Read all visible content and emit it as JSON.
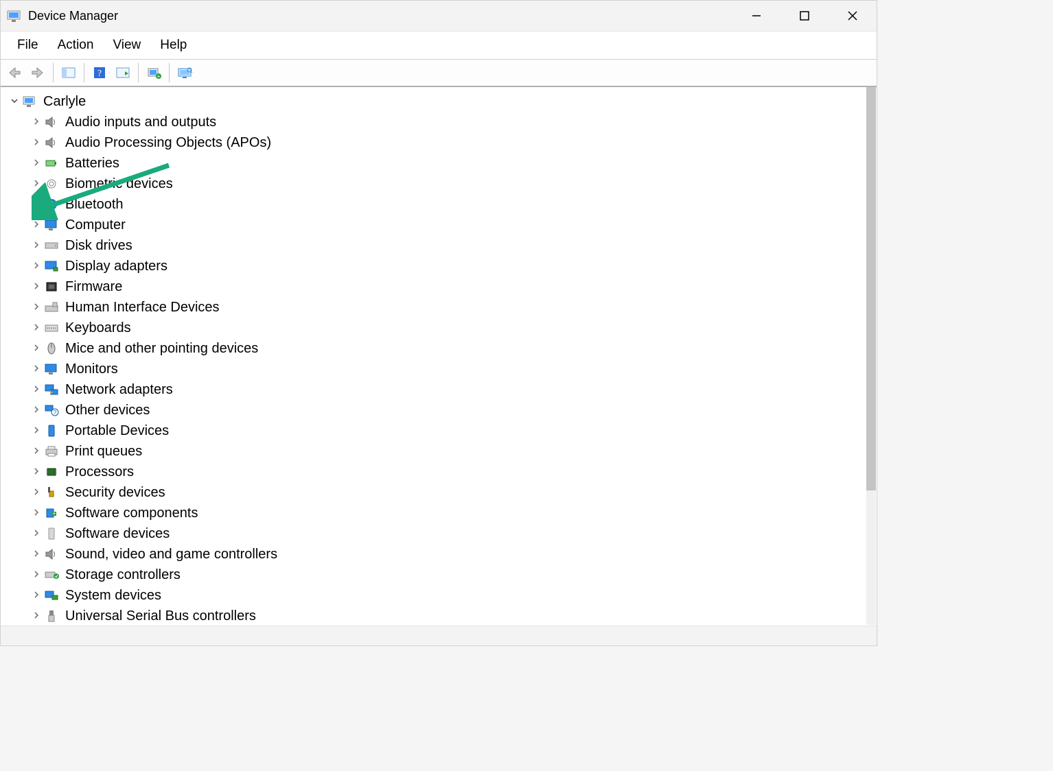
{
  "window": {
    "title": "Device Manager"
  },
  "menu": {
    "file": "File",
    "action": "Action",
    "view": "View",
    "help": "Help"
  },
  "root": {
    "label": "Carlyle"
  },
  "nodes": [
    {
      "label": "Audio inputs and outputs",
      "icon": "speaker"
    },
    {
      "label": "Audio Processing Objects (APOs)",
      "icon": "speaker"
    },
    {
      "label": "Batteries",
      "icon": "battery"
    },
    {
      "label": "Biometric devices",
      "icon": "fingerprint"
    },
    {
      "label": "Bluetooth",
      "icon": "bluetooth"
    },
    {
      "label": "Computer",
      "icon": "monitor"
    },
    {
      "label": "Disk drives",
      "icon": "disk"
    },
    {
      "label": "Display adapters",
      "icon": "display"
    },
    {
      "label": "Firmware",
      "icon": "chip"
    },
    {
      "label": "Human Interface Devices",
      "icon": "hid"
    },
    {
      "label": "Keyboards",
      "icon": "keyboard"
    },
    {
      "label": "Mice and other pointing devices",
      "icon": "mouse"
    },
    {
      "label": "Monitors",
      "icon": "monitor"
    },
    {
      "label": "Network adapters",
      "icon": "network"
    },
    {
      "label": "Other devices",
      "icon": "other"
    },
    {
      "label": "Portable Devices",
      "icon": "portable"
    },
    {
      "label": "Print queues",
      "icon": "printer"
    },
    {
      "label": "Processors",
      "icon": "cpu"
    },
    {
      "label": "Security devices",
      "icon": "security"
    },
    {
      "label": "Software components",
      "icon": "softcomp"
    },
    {
      "label": "Software devices",
      "icon": "softdev"
    },
    {
      "label": "Sound, video and game controllers",
      "icon": "speaker"
    },
    {
      "label": "Storage controllers",
      "icon": "storage"
    },
    {
      "label": "System devices",
      "icon": "system"
    },
    {
      "label": "Universal Serial Bus controllers",
      "icon": "usb"
    }
  ]
}
